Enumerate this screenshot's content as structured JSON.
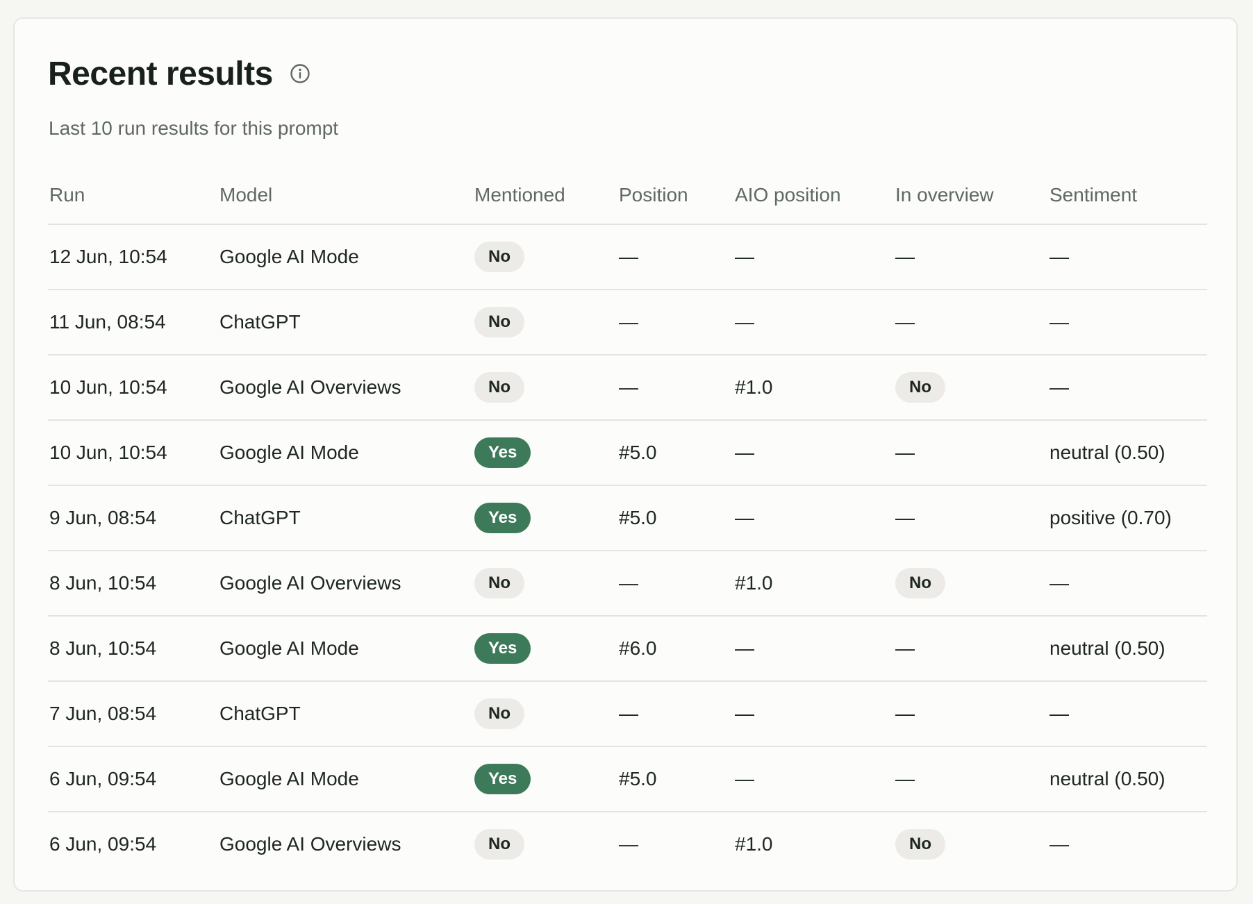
{
  "card": {
    "title": "Recent results",
    "subtitle": "Last 10 run results for this prompt",
    "info_icon": "info-icon"
  },
  "table": {
    "columns": [
      "Run",
      "Model",
      "Mentioned",
      "Position",
      "AIO position",
      "In overview",
      "Sentiment"
    ],
    "rows": [
      {
        "run": "12 Jun, 10:54",
        "model": "Google AI Mode",
        "mentioned": "No",
        "position": "—",
        "aio_position": "—",
        "in_overview": "—",
        "sentiment": "—"
      },
      {
        "run": "11 Jun, 08:54",
        "model": "ChatGPT",
        "mentioned": "No",
        "position": "—",
        "aio_position": "—",
        "in_overview": "—",
        "sentiment": "—"
      },
      {
        "run": "10 Jun, 10:54",
        "model": "Google AI Overviews",
        "mentioned": "No",
        "position": "—",
        "aio_position": "#1.0",
        "in_overview": "No",
        "sentiment": "—"
      },
      {
        "run": "10 Jun, 10:54",
        "model": "Google AI Mode",
        "mentioned": "Yes",
        "position": "#5.0",
        "aio_position": "—",
        "in_overview": "—",
        "sentiment": "neutral (0.50)"
      },
      {
        "run": "9 Jun, 08:54",
        "model": "ChatGPT",
        "mentioned": "Yes",
        "position": "#5.0",
        "aio_position": "—",
        "in_overview": "—",
        "sentiment": "positive (0.70)"
      },
      {
        "run": "8 Jun, 10:54",
        "model": "Google AI Overviews",
        "mentioned": "No",
        "position": "—",
        "aio_position": "#1.0",
        "in_overview": "No",
        "sentiment": "—"
      },
      {
        "run": "8 Jun, 10:54",
        "model": "Google AI Mode",
        "mentioned": "Yes",
        "position": "#6.0",
        "aio_position": "—",
        "in_overview": "—",
        "sentiment": "neutral (0.50)"
      },
      {
        "run": "7 Jun, 08:54",
        "model": "ChatGPT",
        "mentioned": "No",
        "position": "—",
        "aio_position": "—",
        "in_overview": "—",
        "sentiment": "—"
      },
      {
        "run": "6 Jun, 09:54",
        "model": "Google AI Mode",
        "mentioned": "Yes",
        "position": "#5.0",
        "aio_position": "—",
        "in_overview": "—",
        "sentiment": "neutral (0.50)"
      },
      {
        "run": "6 Jun, 09:54",
        "model": "Google AI Overviews",
        "mentioned": "No",
        "position": "—",
        "aio_position": "#1.0",
        "in_overview": "No",
        "sentiment": "—"
      }
    ]
  },
  "colors": {
    "yes_badge": "#3c7a5a",
    "no_badge": "#ecebe7",
    "title_text": "#17201b",
    "muted_text": "#5f6863"
  }
}
